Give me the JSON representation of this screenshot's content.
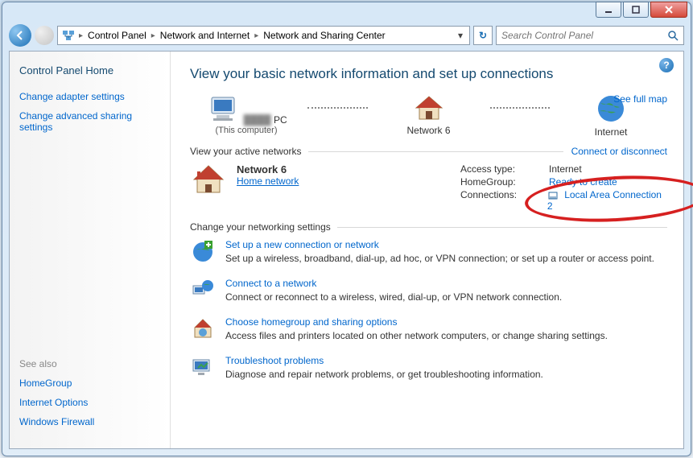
{
  "breadcrumbs": {
    "items": [
      "Control Panel",
      "Network and Internet",
      "Network and Sharing Center"
    ]
  },
  "search": {
    "placeholder": "Search Control Panel"
  },
  "sidebar": {
    "home": "Control Panel Home",
    "links": [
      "Change adapter settings",
      "Change advanced sharing settings"
    ],
    "see_also_hdr": "See also",
    "see_also": [
      "HomeGroup",
      "Internet Options",
      "Windows Firewall"
    ]
  },
  "main": {
    "heading": "View your basic network information and set up connections",
    "full_map": "See full map",
    "map": {
      "pc_name": "PC",
      "pc_sub": "(This computer)",
      "network_name": "Network  6",
      "internet": "Internet"
    },
    "active_hdr": "View your active networks",
    "active_link": "Connect or disconnect",
    "network": {
      "name": "Network  6",
      "type": "Home network"
    },
    "details": {
      "access_k": "Access type:",
      "access_v": "Internet",
      "hg_k": "HomeGroup:",
      "hg_v": "Ready to create",
      "conn_k": "Connections:",
      "conn_v": "Local Area Connection 2"
    },
    "change_hdr": "Change your networking settings",
    "tasks": [
      {
        "title": "Set up a new connection or network",
        "desc": "Set up a wireless, broadband, dial-up, ad hoc, or VPN connection; or set up a router or access point."
      },
      {
        "title": "Connect to a network",
        "desc": "Connect or reconnect to a wireless, wired, dial-up, or VPN network connection."
      },
      {
        "title": "Choose homegroup and sharing options",
        "desc": "Access files and printers located on other network computers, or change sharing settings."
      },
      {
        "title": "Troubleshoot problems",
        "desc": "Diagnose and repair network problems, or get troubleshooting information."
      }
    ]
  }
}
